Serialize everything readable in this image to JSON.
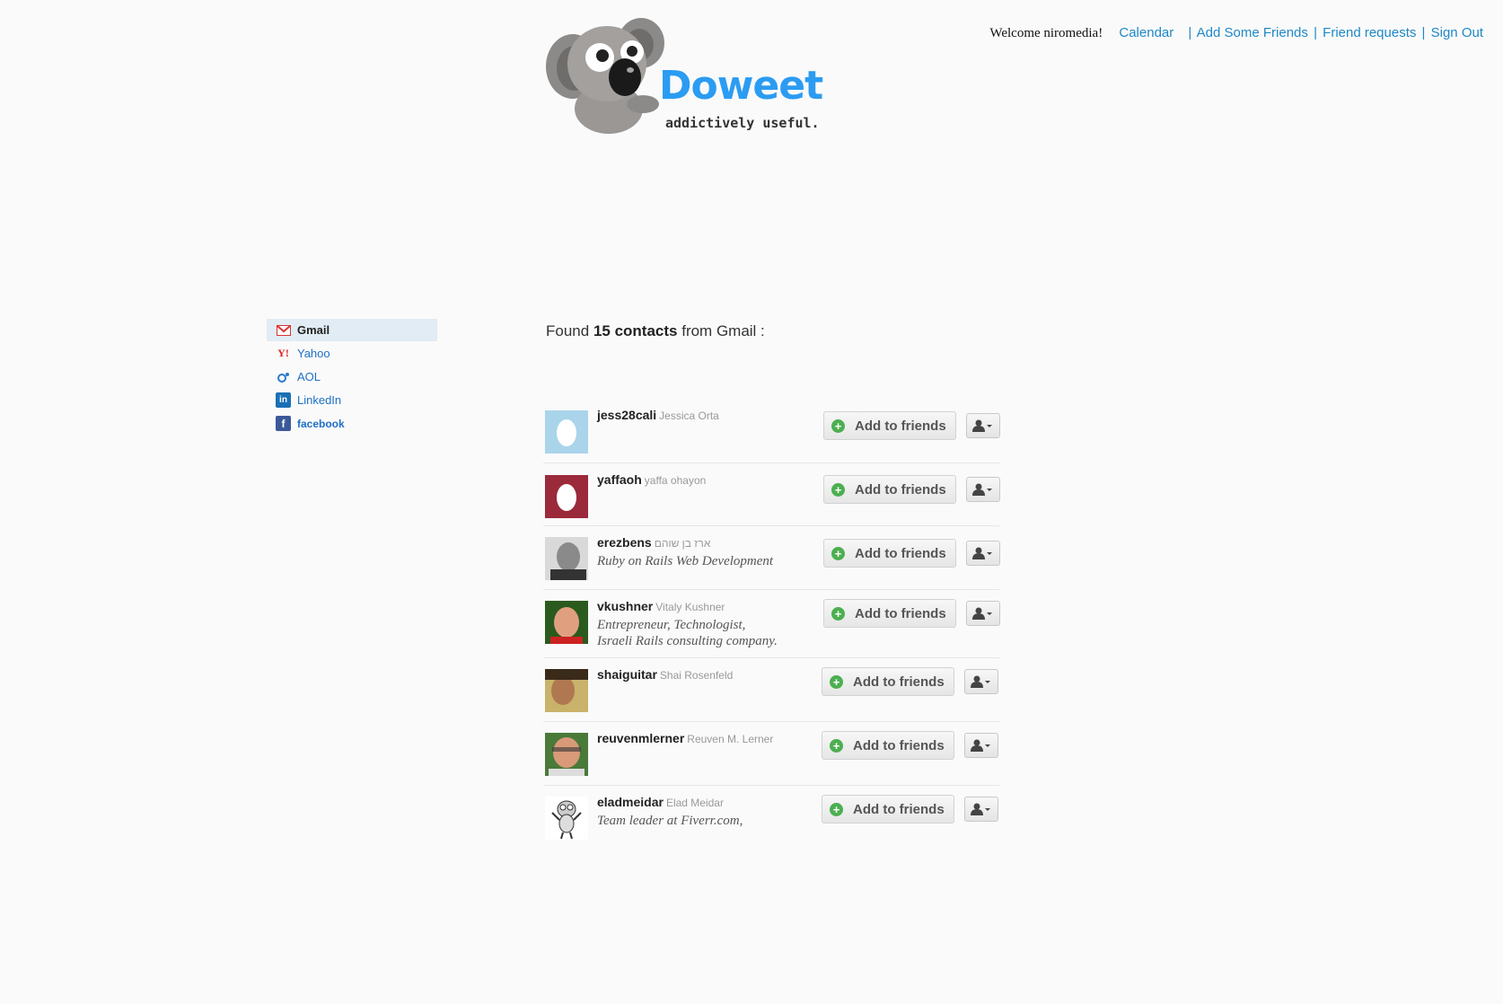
{
  "nav": {
    "welcome": "Welcome niromedia!",
    "calendar": "Calendar",
    "add_friends": "Add Some Friends",
    "friend_requests": "Friend requests",
    "sign_out": "Sign Out",
    "separator": "|"
  },
  "logo": {
    "wordmark": "Doweet",
    "tagline": "addictively useful.",
    "brand_color": "#2b9cf2"
  },
  "sidebar": {
    "items": [
      {
        "label": "Gmail",
        "icon": "gmail-icon",
        "active": true
      },
      {
        "label": "Yahoo",
        "icon": "yahoo-icon",
        "active": false
      },
      {
        "label": "AOL",
        "icon": "aol-icon",
        "active": false
      },
      {
        "label": "LinkedIn",
        "icon": "linkedin-icon",
        "active": false
      },
      {
        "label": "facebook",
        "icon": "facebook-icon",
        "active": false
      }
    ]
  },
  "found": {
    "prefix": "Found",
    "count_label": "15 contacts",
    "suffix": "from Gmail :"
  },
  "contacts": [
    {
      "username": "jess28cali",
      "name": "Jessica Orta",
      "bio": [],
      "avatar": "egg-avatar-lightblue",
      "add_label": "Add to friends"
    },
    {
      "username": "yaffaoh",
      "name": "yaffa ohayon",
      "bio": [],
      "avatar": "egg-avatar-maroon",
      "add_label": "Add to friends"
    },
    {
      "username": "erezbens",
      "name": "ארז בן שוהם",
      "bio": [
        "Ruby on Rails Web Development"
      ],
      "avatar": "photo-avatar",
      "add_label": "Add to friends"
    },
    {
      "username": "vkushner",
      "name": "Vitaly Kushner",
      "bio": [
        "Entrepreneur, Technologist,",
        "Israeli Rails consulting company."
      ],
      "avatar": "photo-avatar",
      "add_label": "Add to friends"
    },
    {
      "username": "shaiguitar",
      "name": "Shai Rosenfeld",
      "bio": [],
      "avatar": "photo-avatar",
      "add_label": "Add to friends"
    },
    {
      "username": "reuvenmlerner",
      "name": "Reuven M. Lerner",
      "bio": [],
      "avatar": "photo-avatar",
      "add_label": "Add to friends"
    },
    {
      "username": "eladmeidar",
      "name": "Elad Meidar",
      "bio": [
        "Team leader at Fiverr.com,"
      ],
      "avatar": "cartoon-avatar",
      "add_label": "Add to friends"
    }
  ]
}
